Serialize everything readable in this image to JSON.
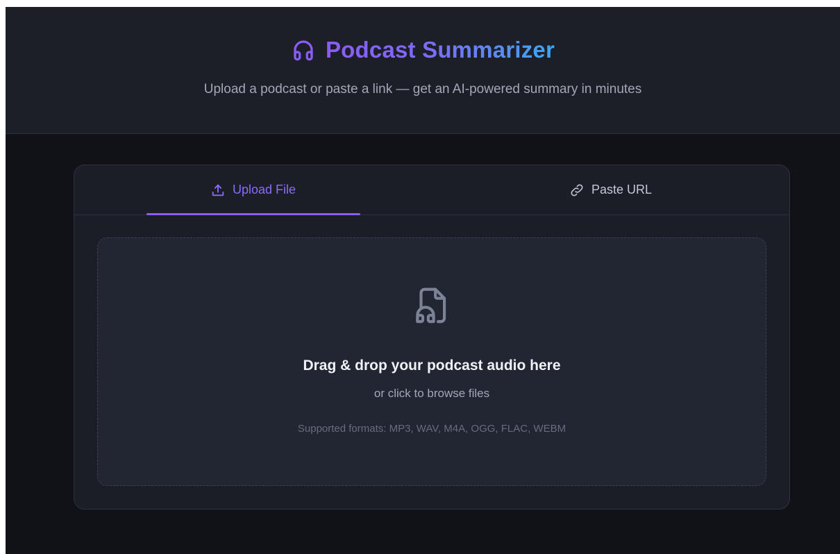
{
  "header": {
    "title": "Podcast Summarizer",
    "subtitle": "Upload a podcast or paste a link — get an AI-powered summary in minutes",
    "logo_icon": "headphones-icon"
  },
  "tabs": [
    {
      "label": "Upload File",
      "icon": "upload-icon",
      "active": true
    },
    {
      "label": "Paste URL",
      "icon": "link-icon",
      "active": false
    }
  ],
  "dropzone": {
    "icon": "audio-file-icon",
    "title": "Drag & drop your podcast audio here",
    "subtitle": "or click to browse files",
    "formats": "Supported formats: MP3, WAV, M4A, OGG, FLAC, WEBM"
  },
  "colors": {
    "accent": "#8b5cf6",
    "title_gradient_end": "#3fa6f2",
    "background": "#111217",
    "header_bg": "#1c1f28",
    "card_bg": "#1b1e27",
    "dropzone_bg": "#222532"
  }
}
